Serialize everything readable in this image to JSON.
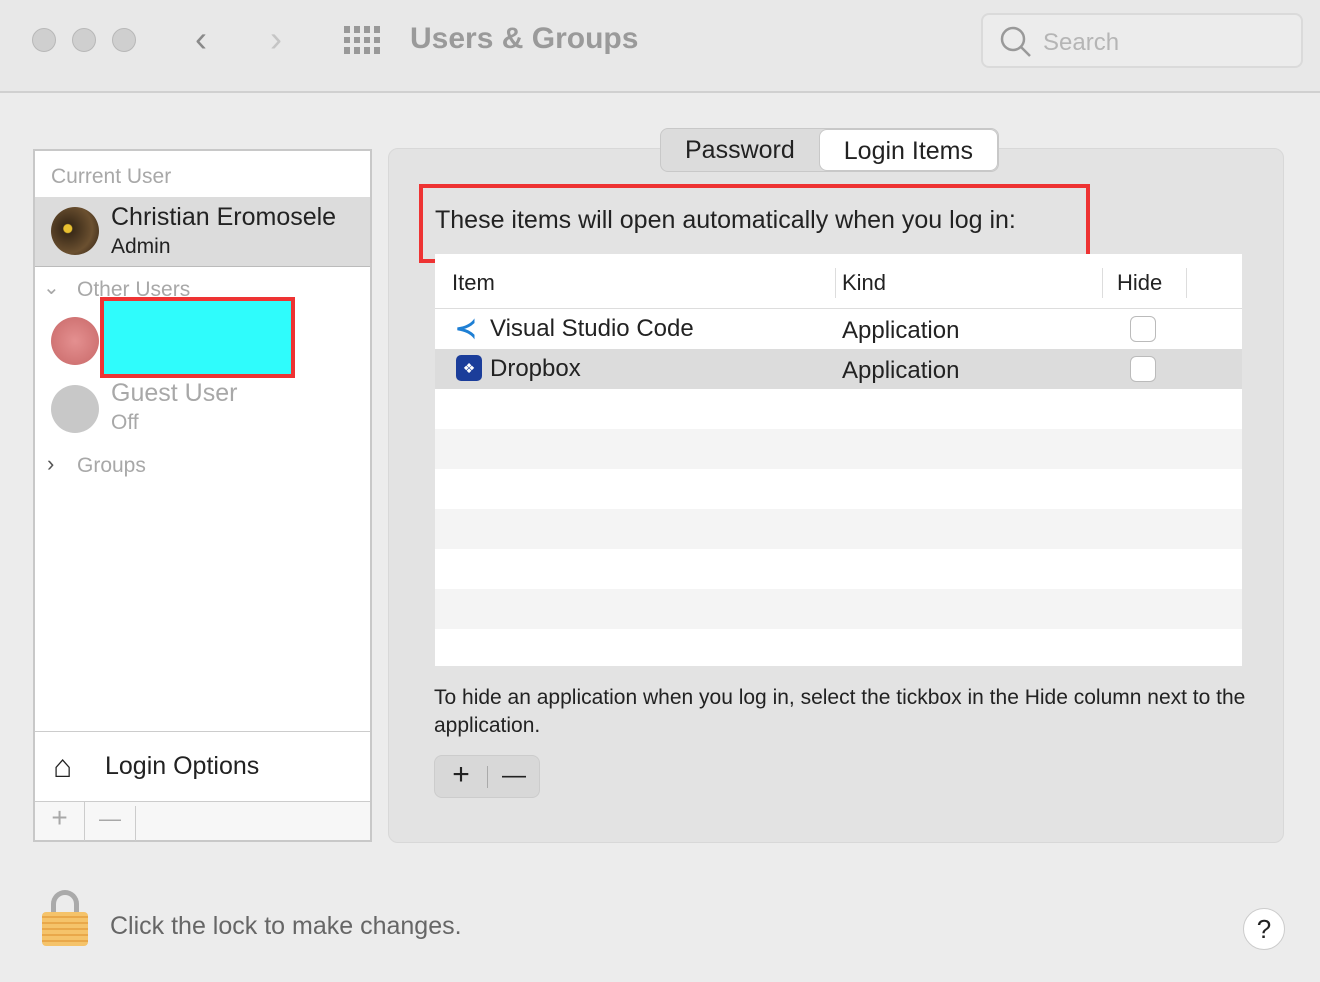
{
  "window": {
    "title": "Users & Groups",
    "search_placeholder": "Search"
  },
  "sidebar": {
    "current_user_header": "Current User",
    "current_user": {
      "name": "Christian Eromosele",
      "role": "Admin"
    },
    "other_users_header": "Other Users",
    "guest": {
      "name": "Guest User",
      "status": "Off"
    },
    "groups": "Groups",
    "login_options": "Login Options",
    "add": "+",
    "remove": "—"
  },
  "tabs": [
    {
      "label": "Password"
    },
    {
      "label": "Login Items",
      "selected": true
    }
  ],
  "main": {
    "heading": "These items will open automatically when you log in:",
    "columns": [
      "Item",
      "Kind",
      "Hide"
    ],
    "items": [
      {
        "name": "Visual Studio Code",
        "kind": "Application",
        "hide": false
      },
      {
        "name": "Dropbox",
        "kind": "Application",
        "hide": false
      }
    ],
    "hint": "To hide an application when you log in, select the tickbox in the Hide column next to the application.",
    "add": "+",
    "remove": "—"
  },
  "footer": {
    "lock_text": "Click the lock to make changes.",
    "help": "?"
  }
}
